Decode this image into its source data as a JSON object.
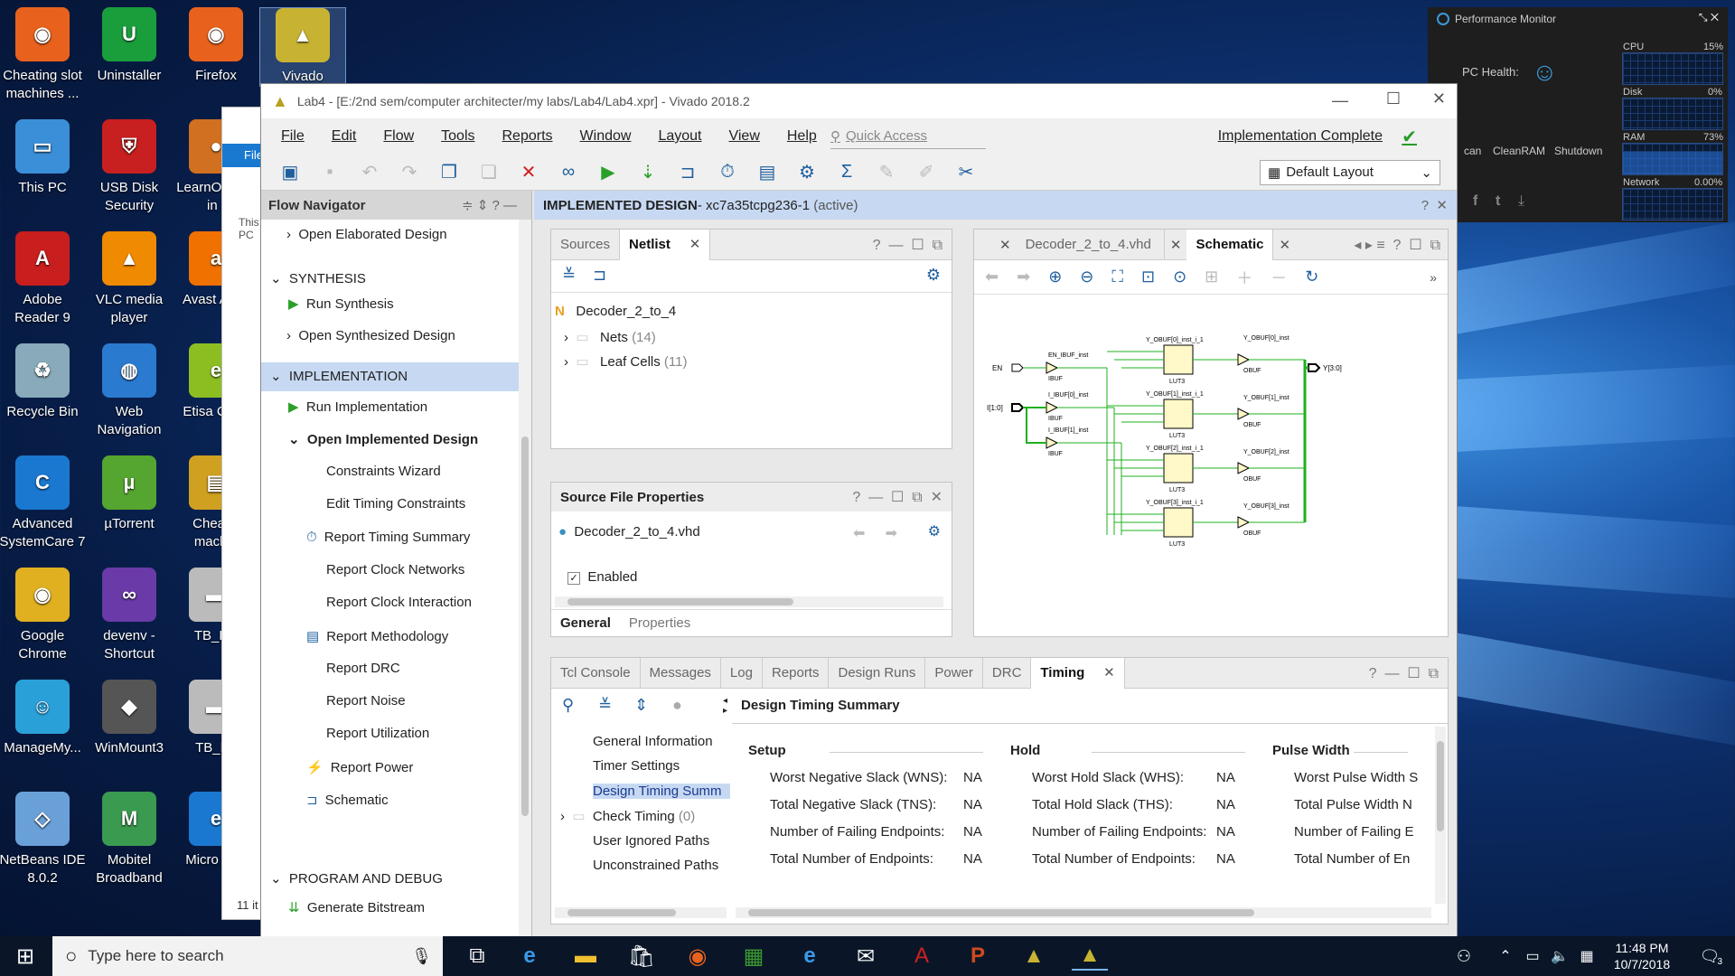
{
  "desktop": {
    "icons": [
      {
        "label": "Cheating slot machines  ...",
        "color": "#e8621d",
        "glyph": "◉"
      },
      {
        "label": "Uninstaller",
        "color": "#1a9e3c",
        "glyph": "U"
      },
      {
        "label": "Firefox",
        "color": "#e8621d",
        "glyph": "◉"
      },
      {
        "label": "Vivado",
        "color": "#c8b232",
        "glyph": "▲"
      },
      {
        "label": "This PC",
        "color": "#3a8fd8",
        "glyph": "▭"
      },
      {
        "label": "USB Disk Security",
        "color": "#c82020",
        "glyph": "⛨"
      },
      {
        "label": "LearnOn Log in t",
        "color": "#d07020",
        "glyph": "●"
      },
      {
        "label": "Adobe Reader 9",
        "color": "#c81e1e",
        "glyph": "A"
      },
      {
        "label": "VLC media player",
        "color": "#f08a00",
        "glyph": "▲"
      },
      {
        "label": "Avast Antiv",
        "color": "#f07000",
        "glyph": "a"
      },
      {
        "label": "Recycle Bin",
        "color": "#8ab",
        "glyph": "♻"
      },
      {
        "label": "Web Navigation",
        "color": "#2a7ad0",
        "glyph": "◍"
      },
      {
        "label": "Etisa Conn",
        "color": "#8cbe22",
        "glyph": "e"
      },
      {
        "label": "Advanced SystemCare 7",
        "color": "#1a78d0",
        "glyph": "C"
      },
      {
        "label": "µTorrent",
        "color": "#55a630",
        "glyph": "µ"
      },
      {
        "label": "Cheatin machin",
        "color": "#d0a020",
        "glyph": "▤"
      },
      {
        "label": "Google Chrome",
        "color": "#e0b020",
        "glyph": "◉"
      },
      {
        "label": "devenv - Shortcut",
        "color": "#6a3aa8",
        "glyph": "∞"
      },
      {
        "label": "TB_HA",
        "color": "#bbb",
        "glyph": "▬"
      },
      {
        "label": "ManageMy...",
        "color": "#2aa0d8",
        "glyph": "☺"
      },
      {
        "label": "WinMount3",
        "color": "#555",
        "glyph": "◆"
      },
      {
        "label": "TB_FA",
        "color": "#bbb",
        "glyph": "▬"
      },
      {
        "label": "NetBeans IDE 8.0.2",
        "color": "#6aa0d8",
        "glyph": "◇"
      },
      {
        "label": "Mobitel Broadband",
        "color": "#3a9a50",
        "glyph": "M"
      },
      {
        "label": "Micro Edg",
        "color": "#1a78d0",
        "glyph": "e"
      }
    ]
  },
  "explorer_behind": {
    "file": "File",
    "this_pc": "This PC",
    "items": "11 it"
  },
  "perf": {
    "title": "Performance Monitor",
    "health": "PC Health:",
    "cpu": "CPU",
    "cpu_val": "15%",
    "disk": "Disk",
    "disk_val": "0%",
    "ram": "RAM",
    "ram_val": "73%",
    "net": "Network",
    "net_val": "0.00%",
    "scan": "can",
    "cleanram": "CleanRAM",
    "shutdown": "Shutdown"
  },
  "vivado": {
    "title": "Lab4 - [E:/2nd sem/computer architecter/my labs/Lab4/Lab4.xpr] - Vivado 2018.2",
    "menu": [
      "File",
      "Edit",
      "Flow",
      "Tools",
      "Reports",
      "Window",
      "Layout",
      "View",
      "Help"
    ],
    "quick_access": "Quick Access",
    "status": "Implementation Complete",
    "layout_select": "Default Layout",
    "flow_nav": {
      "title": "Flow Navigator",
      "open_elab": "Open Elaborated Design",
      "synthesis": "SYNTHESIS",
      "run_synth": "Run Synthesis",
      "open_synth": "Open Synthesized Design",
      "implementation": "IMPLEMENTATION",
      "run_impl": "Run Implementation",
      "open_impl": "Open Implemented Design",
      "sub": [
        "Constraints Wizard",
        "Edit Timing Constraints",
        "Report Timing Summary",
        "Report Clock Networks",
        "Report Clock Interaction",
        "Report Methodology",
        "Report DRC",
        "Report Noise",
        "Report Utilization",
        "Report Power",
        "Schematic"
      ],
      "program": "PROGRAM AND DEBUG",
      "gen_bit": "Generate Bitstream"
    },
    "design_header": {
      "label": "IMPLEMENTED DESIGN",
      "part": " - xc7a35tcpg236-1",
      "active": "(active)"
    },
    "netlist": {
      "tabs": [
        "Sources",
        "Netlist"
      ],
      "root": "Decoder_2_to_4",
      "nets": "Nets",
      "nets_count": "(14)",
      "cells": "Leaf Cells",
      "cells_count": "(11)"
    },
    "props": {
      "title": "Source File Properties",
      "file": "Decoder_2_to_4.vhd",
      "enabled": "Enabled",
      "tabs": [
        "General",
        "Properties"
      ]
    },
    "schematic": {
      "tabs": [
        "Decoder_2_to_4.vhd",
        "Schematic"
      ],
      "labels": {
        "en": "EN",
        "in": "I[1:0]",
        "out": "Y[3:0]",
        "en_ibuf": "EN_IBUF_inst",
        "ibuf": "IBUF",
        "i0": "I_IBUF[0]_inst",
        "i1": "I_IBUF[1]_inst",
        "lut": "LUT3",
        "obuf": "OBUF",
        "lut_names": [
          "Y_OBUF[0]_inst_i_1",
          "Y_OBUF[1]_inst_i_1",
          "Y_OBUF[2]_inst_i_1",
          "Y_OBUF[3]_inst_i_1"
        ],
        "obuf_names": [
          "Y_OBUF[0]_inst",
          "Y_OBUF[1]_inst",
          "Y_OBUF[2]_inst",
          "Y_OBUF[3]_inst"
        ]
      }
    },
    "bottom": {
      "tabs": [
        "Tcl Console",
        "Messages",
        "Log",
        "Reports",
        "Design Runs",
        "Power",
        "DRC",
        "Timing"
      ],
      "tree": [
        "General Information",
        "Timer Settings",
        "Design Timing Summ",
        "Check Timing",
        "User Ignored Paths",
        "Unconstrained Paths"
      ],
      "check_count": "(0)",
      "summary_title": "Design Timing Summary",
      "setup": {
        "title": "Setup",
        "rows": [
          [
            "Worst Negative Slack (WNS):",
            "NA"
          ],
          [
            "Total Negative Slack (TNS):",
            "NA"
          ],
          [
            "Number of Failing Endpoints:",
            "NA"
          ],
          [
            "Total Number of Endpoints:",
            "NA"
          ]
        ]
      },
      "hold": {
        "title": "Hold",
        "rows": [
          [
            "Worst Hold Slack (WHS):",
            "NA"
          ],
          [
            "Total Hold Slack (THS):",
            "NA"
          ],
          [
            "Number of Failing Endpoints:",
            "NA"
          ],
          [
            "Total Number of Endpoints:",
            "NA"
          ]
        ]
      },
      "pulse": {
        "title": "Pulse Width",
        "rows": [
          "Worst Pulse Width S",
          "Total Pulse Width N",
          "Number of Failing E",
          "Total Number of En"
        ]
      }
    }
  },
  "taskbar": {
    "search": "Type here to search",
    "time": "11:48 PM",
    "date": "10/7/2018",
    "notif": "3"
  }
}
